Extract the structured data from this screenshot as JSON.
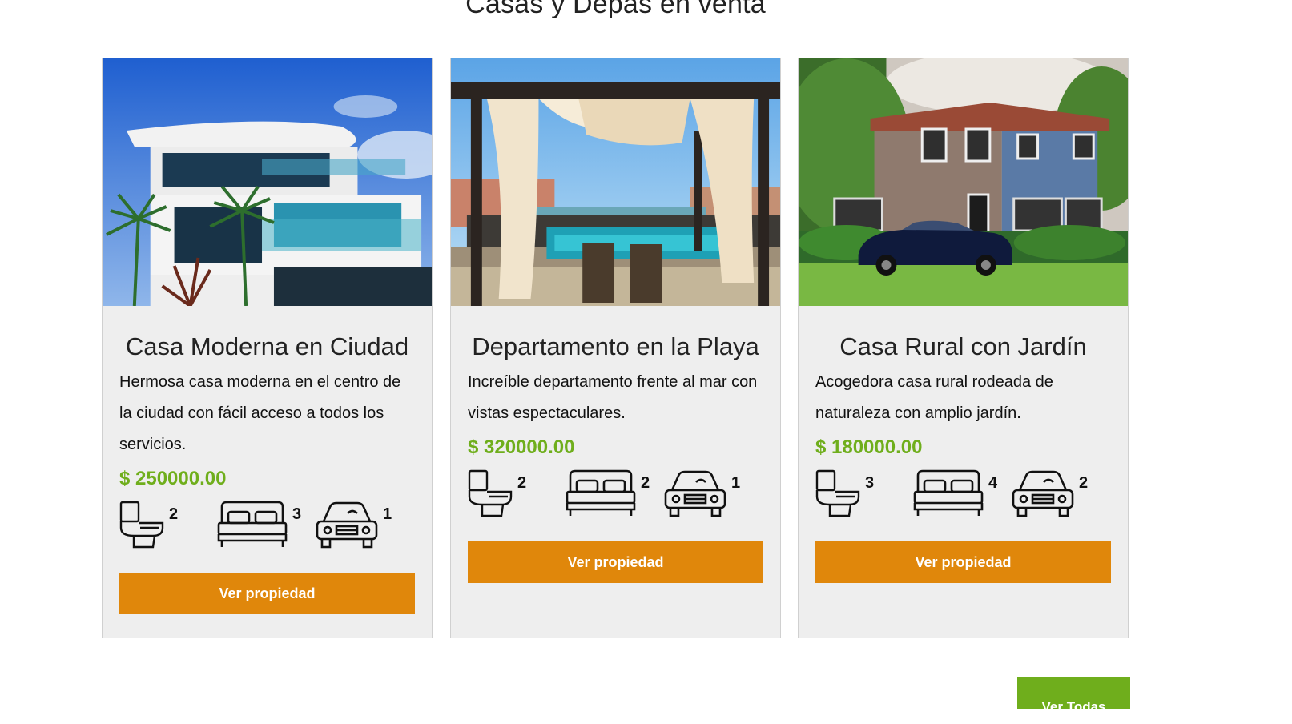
{
  "section": {
    "title": "Casas y Depas en venta"
  },
  "properties": [
    {
      "title": "Casa Moderna en Ciudad",
      "description": "Hermosa casa moderna en el centro de la ciudad con fácil acceso a todos los servicios.",
      "price": "$ 250000.00",
      "bathrooms": "2",
      "bedrooms": "3",
      "parking": "1",
      "button_label": "Ver propiedad"
    },
    {
      "title": "Departamento en la Playa",
      "description": "Increíble departamento frente al mar con vistas espectaculares.",
      "price": "$ 320000.00",
      "bathrooms": "2",
      "bedrooms": "2",
      "parking": "1",
      "button_label": "Ver propiedad"
    },
    {
      "title": "Casa Rural con Jardín",
      "description": "Acogedora casa rural rodeada de naturaleza con amplio jardín.",
      "price": "$ 180000.00",
      "bathrooms": "3",
      "bedrooms": "4",
      "parking": "2",
      "button_label": "Ver propiedad"
    }
  ],
  "footer": {
    "view_all_label": "Ver Todas"
  },
  "colors": {
    "accent_orange": "#e0870b",
    "price_green": "#6fae1c",
    "card_bg": "#eeeeee"
  }
}
